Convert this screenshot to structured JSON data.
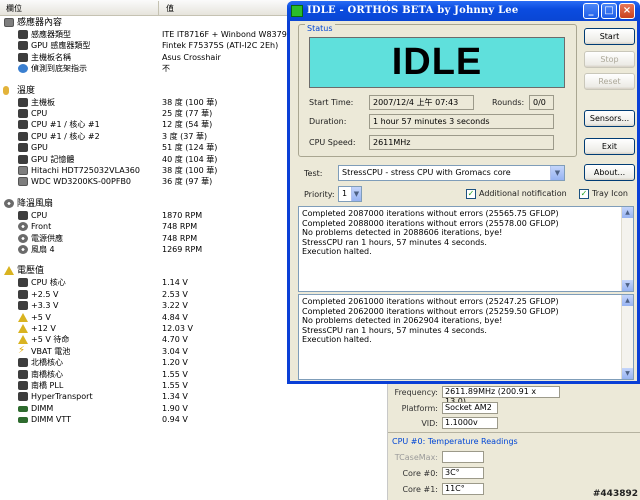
{
  "sensor_panel": {
    "col_item": "欄位",
    "col_value": "值",
    "groups": [
      {
        "title": "感應器內容",
        "icon": "hardware-icon",
        "rows": [
          {
            "label": "感應器類型",
            "value": "ITE IT8716F + Winbond W83791",
            "icon": "chip-icon"
          },
          {
            "label": "GPU 感應器類型",
            "value": "Fintek F75375S  (ATI-I2C 2Eh)",
            "icon": "chip-icon"
          },
          {
            "label": "主機板名稱",
            "value": "Asus Crosshair",
            "icon": "motherboard-icon"
          },
          {
            "label": "偵測到底架指示",
            "value": "不",
            "icon": "info-icon"
          }
        ]
      },
      {
        "title": "溫度",
        "icon": "temperature-icon",
        "rows": [
          {
            "label": "主機板",
            "value": "38 度  (100 華)",
            "icon": "motherboard-icon"
          },
          {
            "label": "CPU",
            "value": "25 度  (77 華)",
            "icon": "cpu-icon"
          },
          {
            "label": "CPU #1 / 核心 #1",
            "value": "12 度  (54 華)",
            "icon": "cpu-icon"
          },
          {
            "label": "CPU #1 / 核心 #2",
            "value": "3 度  (37 華)",
            "icon": "cpu-icon"
          },
          {
            "label": "GPU",
            "value": "51 度  (124 華)",
            "icon": "gpu-icon"
          },
          {
            "label": "GPU 記憶體",
            "value": "40 度  (104 華)",
            "icon": "gpu-memory-icon"
          },
          {
            "label": "Hitachi HDT725032VLA360",
            "value": "38 度  (100 華)",
            "icon": "disk-icon"
          },
          {
            "label": "WDC WD3200KS-00PFB0",
            "value": "36 度  (97 華)",
            "icon": "disk-icon"
          }
        ]
      },
      {
        "title": "降溫風扇",
        "icon": "fan-icon",
        "rows": [
          {
            "label": "CPU",
            "value": "1870 RPM",
            "icon": "cpu-icon"
          },
          {
            "label": "Front",
            "value": "748 RPM",
            "icon": "fan-icon"
          },
          {
            "label": "電源供應",
            "value": "748 RPM",
            "icon": "fan-icon"
          },
          {
            "label": "風扇 4",
            "value": "1269 RPM",
            "icon": "fan-icon"
          }
        ]
      },
      {
        "title": "電壓值",
        "icon": "voltage-icon",
        "rows": [
          {
            "label": "CPU 核心",
            "value": "1.14 V",
            "icon": "cpu-icon"
          },
          {
            "label": "+2.5 V",
            "value": "2.53 V",
            "icon": "chip-icon"
          },
          {
            "label": "+3.3 V",
            "value": "3.22 V",
            "icon": "chip-icon"
          },
          {
            "label": "+5 V",
            "value": "4.84 V",
            "icon": "voltage-icon"
          },
          {
            "label": "+12 V",
            "value": "12.03 V",
            "icon": "voltage-icon"
          },
          {
            "label": "+5 V 待命",
            "value": "4.70 V",
            "icon": "voltage-icon"
          },
          {
            "label": "VBAT 電池",
            "value": "3.04 V",
            "icon": "battery-icon"
          },
          {
            "label": "北橋核心",
            "value": "1.20 V",
            "icon": "chip-icon"
          },
          {
            "label": "南橋核心",
            "value": "1.55 V",
            "icon": "chip-icon"
          },
          {
            "label": "南橋 PLL",
            "value": "1.55 V",
            "icon": "chip-icon"
          },
          {
            "label": "HyperTransport",
            "value": "1.34 V",
            "icon": "chip-icon"
          },
          {
            "label": "DIMM",
            "value": "1.90 V",
            "icon": "memory-icon"
          },
          {
            "label": "DIMM VTT",
            "value": "0.94 V",
            "icon": "memory-icon"
          }
        ]
      }
    ]
  },
  "orthos": {
    "title": "IDLE - ORTHOS BETA by Johnny Lee",
    "status_legend": "Status",
    "state": "IDLE",
    "start_time_label": "Start Time:",
    "start_time": "2007/12/4 上午 07:43",
    "rounds_label": "Rounds:",
    "rounds": "0/0",
    "duration_label": "Duration:",
    "duration": "1 hour 57 minutes 3 seconds",
    "cpu_speed_label": "CPU Speed:",
    "cpu_speed": "2611MHz",
    "buttons": {
      "start": "Start",
      "stop": "Stop",
      "reset": "Reset",
      "sensors": "Sensors...",
      "exit": "Exit",
      "about": "About..."
    },
    "test_label": "Test:",
    "test_value": "StressCPU - stress CPU with Gromacs core",
    "priority_label": "Priority:",
    "priority_value": "1",
    "additional_notification": "Additional notification",
    "tray_icon": "Tray Icon",
    "log1": [
      "Completed 2087000 iterations without errors (25565.75 GFLOP)",
      "Completed 2088000 iterations without errors (25578.00 GFLOP)",
      "No problems detected in 2088606 iterations, bye!",
      "StressCPU ran 1 hours, 57 minutes 4 seconds.",
      "Execution halted."
    ],
    "log2": [
      "Completed 2061000 iterations without errors (25247.25 GFLOP)",
      "Completed 2062000 iterations without errors (25259.50 GFLOP)",
      "No problems detected in 2062904 iterations, bye!",
      "StressCPU ran 1 hours, 57 minutes 4 seconds.",
      "Execution halted."
    ]
  },
  "cpu_panel": {
    "frequency_label": "Frequency:",
    "frequency": "2611.89MHz (200.91 x 13.0)",
    "platform_label": "Platform:",
    "platform": "Socket AM2",
    "vid_label": "VID:",
    "vid": "1.1000v",
    "temp_legend": "CPU #0: Temperature Readings",
    "tcasemax_label": "TCaseMax:",
    "tcasemax": "",
    "core0_label": "Core #0:",
    "core0": "3C°",
    "core1_label": "Core #1:",
    "core1": "11C°"
  },
  "watermark": "#443892"
}
